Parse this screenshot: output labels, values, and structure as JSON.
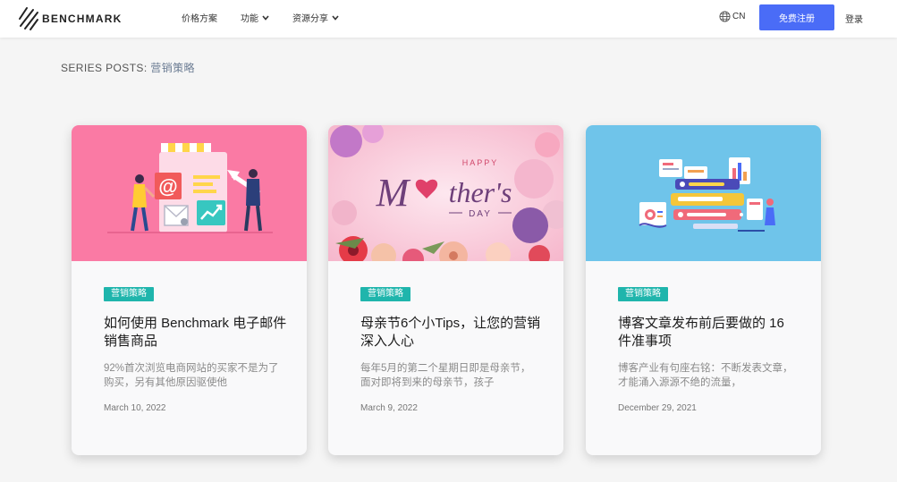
{
  "header": {
    "logo_text": "BENCHMARK",
    "nav": [
      {
        "label": "价格方案"
      },
      {
        "label": "功能"
      },
      {
        "label": "资源分享"
      }
    ],
    "lang": "CN",
    "signup": "免费注册",
    "login": "登录"
  },
  "series": {
    "prefix": "SERIES POSTS:",
    "category": "营销策略"
  },
  "cards": [
    {
      "image": "email-marketing-illustration",
      "badge": "营销策略",
      "title": "如何使用 Benchmark 电子邮件销售商品",
      "excerpt": "92%首次浏览电商网站的买家不是为了购买，另有其他原因驱使他",
      "date": "March 10, 2022",
      "img_text": "@"
    },
    {
      "image": "mothers-day-banner",
      "badge": "营销策略",
      "title": "母亲节6个小Tips，让您的营销深入人心",
      "excerpt": "每年5月的第二个星期日即是母亲节，面对即将到来的母亲节，孩子",
      "date": "March 9, 2022",
      "img_happy": "HAPPY",
      "img_m": "M",
      "img_thers": "ther's",
      "img_day": "DAY"
    },
    {
      "image": "blog-checklist-illustration",
      "badge": "营销策略",
      "title": "博客文章发布前后要做的 16 件准事项",
      "excerpt": "博客产业有句座右铭：不断发表文章，才能涌入源源不绝的流量，",
      "date": "December 29, 2021"
    }
  ],
  "colors": {
    "primary": "#4a6cf7",
    "badge": "#1fb5ac",
    "card1_bg": "#fa7aa4",
    "card2_bg": "#fbd3e0",
    "card3_bg": "#6fc4ea"
  }
}
